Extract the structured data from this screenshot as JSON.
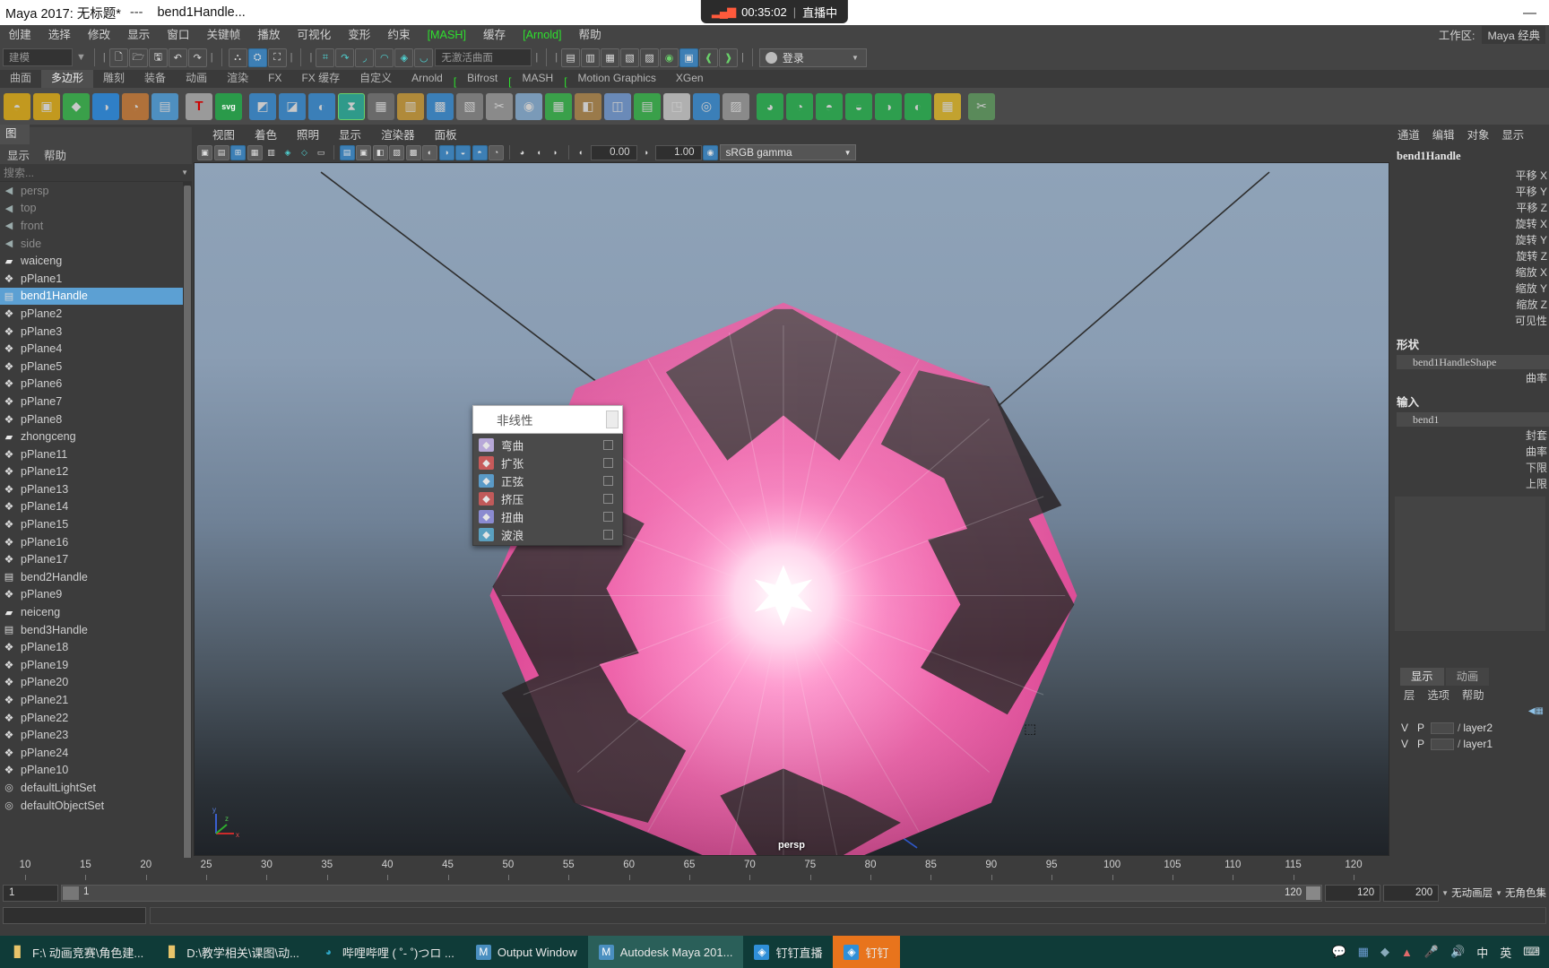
{
  "window": {
    "title_app": "Maya 2017: 无标题*",
    "title_sep": "---",
    "title_doc": "bend1Handle...",
    "minimize": "—",
    "live_timer": "00:35:02",
    "live_divider": "|",
    "live_label": "直播中"
  },
  "menubar": {
    "items": [
      {
        "label": "创建",
        "green": false
      },
      {
        "label": "选择",
        "green": false
      },
      {
        "label": "修改",
        "green": false
      },
      {
        "label": "显示",
        "green": false
      },
      {
        "label": "窗口",
        "green": false
      },
      {
        "label": "关键帧",
        "green": false
      },
      {
        "label": "播放",
        "green": false
      },
      {
        "label": "可视化",
        "green": false
      },
      {
        "label": "变形",
        "green": false
      },
      {
        "label": "约束",
        "green": false
      },
      {
        "label": "MASH",
        "green": true
      },
      {
        "label": "缓存",
        "green": false
      },
      {
        "label": "Arnold",
        "green": true
      },
      {
        "label": "帮助",
        "green": false
      }
    ],
    "workspace_label": "工作区:",
    "workspace_value": "Maya 经典"
  },
  "statusline": {
    "mode_value": "建模",
    "surface_field": "无激活曲面",
    "login_label": "登录"
  },
  "shelf": {
    "tabs": [
      {
        "label": "曲面",
        "active": false
      },
      {
        "label": "多边形",
        "active": true
      },
      {
        "label": "雕刻",
        "active": false
      },
      {
        "label": "装备",
        "active": false
      },
      {
        "label": "动画",
        "active": false
      },
      {
        "label": "渲染",
        "active": false
      },
      {
        "label": "FX",
        "active": false
      },
      {
        "label": "FX 缓存",
        "active": false
      },
      {
        "label": "自定义",
        "active": false
      },
      {
        "label": "Arnold",
        "active": false
      },
      {
        "label": "Bifrost",
        "active": false
      },
      {
        "label": "MASH",
        "active": false
      },
      {
        "label": "Motion Graphics",
        "active": false
      },
      {
        "label": "XGen",
        "active": false
      }
    ],
    "bracket": "["
  },
  "outliner": {
    "tab_label": "图",
    "menus": [
      "显示",
      "帮助"
    ],
    "search_placeholder": "搜索...",
    "items": [
      {
        "label": "persp",
        "icon": "camera-icon",
        "type": "cam",
        "dim": true,
        "selected": false
      },
      {
        "label": "top",
        "icon": "camera-icon",
        "type": "cam",
        "dim": true,
        "selected": false
      },
      {
        "label": "front",
        "icon": "camera-icon",
        "type": "cam",
        "dim": true,
        "selected": false
      },
      {
        "label": "side",
        "icon": "camera-icon",
        "type": "cam",
        "dim": true,
        "selected": false
      },
      {
        "label": "waiceng",
        "icon": "group-icon",
        "type": "grp",
        "dim": false,
        "selected": false
      },
      {
        "label": "pPlane1",
        "icon": "mesh-icon",
        "type": "mesh",
        "dim": false,
        "selected": false
      },
      {
        "label": "bend1Handle",
        "icon": "deformer-icon",
        "type": "bend",
        "dim": false,
        "selected": true
      },
      {
        "label": "pPlane2",
        "icon": "mesh-icon",
        "type": "mesh",
        "dim": false,
        "selected": false
      },
      {
        "label": "pPlane3",
        "icon": "mesh-icon",
        "type": "mesh",
        "dim": false,
        "selected": false
      },
      {
        "label": "pPlane4",
        "icon": "mesh-icon",
        "type": "mesh",
        "dim": false,
        "selected": false
      },
      {
        "label": "pPlane5",
        "icon": "mesh-icon",
        "type": "mesh",
        "dim": false,
        "selected": false
      },
      {
        "label": "pPlane6",
        "icon": "mesh-icon",
        "type": "mesh",
        "dim": false,
        "selected": false
      },
      {
        "label": "pPlane7",
        "icon": "mesh-icon",
        "type": "mesh",
        "dim": false,
        "selected": false
      },
      {
        "label": "pPlane8",
        "icon": "mesh-icon",
        "type": "mesh",
        "dim": false,
        "selected": false
      },
      {
        "label": "zhongceng",
        "icon": "group-icon",
        "type": "grp",
        "dim": false,
        "selected": false
      },
      {
        "label": "pPlane11",
        "icon": "mesh-icon",
        "type": "mesh",
        "dim": false,
        "selected": false
      },
      {
        "label": "pPlane12",
        "icon": "mesh-icon",
        "type": "mesh",
        "dim": false,
        "selected": false
      },
      {
        "label": "pPlane13",
        "icon": "mesh-icon",
        "type": "mesh",
        "dim": false,
        "selected": false
      },
      {
        "label": "pPlane14",
        "icon": "mesh-icon",
        "type": "mesh",
        "dim": false,
        "selected": false
      },
      {
        "label": "pPlane15",
        "icon": "mesh-icon",
        "type": "mesh",
        "dim": false,
        "selected": false
      },
      {
        "label": "pPlane16",
        "icon": "mesh-icon",
        "type": "mesh",
        "dim": false,
        "selected": false
      },
      {
        "label": "pPlane17",
        "icon": "mesh-icon",
        "type": "mesh",
        "dim": false,
        "selected": false
      },
      {
        "label": "bend2Handle",
        "icon": "deformer-icon",
        "type": "bend",
        "dim": false,
        "selected": false
      },
      {
        "label": "pPlane9",
        "icon": "mesh-icon",
        "type": "mesh",
        "dim": false,
        "selected": false
      },
      {
        "label": "neiceng",
        "icon": "group-icon",
        "type": "grp",
        "dim": false,
        "selected": false
      },
      {
        "label": "bend3Handle",
        "icon": "deformer-icon",
        "type": "bend",
        "dim": false,
        "selected": false
      },
      {
        "label": "pPlane18",
        "icon": "mesh-icon",
        "type": "mesh",
        "dim": false,
        "selected": false
      },
      {
        "label": "pPlane19",
        "icon": "mesh-icon",
        "type": "mesh",
        "dim": false,
        "selected": false
      },
      {
        "label": "pPlane20",
        "icon": "mesh-icon",
        "type": "mesh",
        "dim": false,
        "selected": false
      },
      {
        "label": "pPlane21",
        "icon": "mesh-icon",
        "type": "mesh",
        "dim": false,
        "selected": false
      },
      {
        "label": "pPlane22",
        "icon": "mesh-icon",
        "type": "mesh",
        "dim": false,
        "selected": false
      },
      {
        "label": "pPlane23",
        "icon": "mesh-icon",
        "type": "mesh",
        "dim": false,
        "selected": false
      },
      {
        "label": "pPlane24",
        "icon": "mesh-icon",
        "type": "mesh",
        "dim": false,
        "selected": false
      },
      {
        "label": "pPlane10",
        "icon": "mesh-icon",
        "type": "mesh",
        "dim": false,
        "selected": false
      },
      {
        "label": "defaultLightSet",
        "icon": "set-icon",
        "type": "set",
        "dim": false,
        "selected": false
      },
      {
        "label": "defaultObjectSet",
        "icon": "set-icon",
        "type": "set",
        "dim": false,
        "selected": false
      }
    ]
  },
  "viewport": {
    "menus": [
      "视图",
      "着色",
      "照明",
      "显示",
      "渲染器",
      "面板"
    ],
    "exposure_value": "0.00",
    "gamma_value": "1.00",
    "colorspace_value": "sRGB gamma",
    "camera_label": "persp",
    "axis_x": "x",
    "axis_y": "y",
    "axis_z": "z"
  },
  "popup": {
    "title": "非线性",
    "items": [
      {
        "label": "弯曲",
        "icon": "bend-deformer-icon"
      },
      {
        "label": "扩张",
        "icon": "flare-deformer-icon"
      },
      {
        "label": "正弦",
        "icon": "sine-deformer-icon"
      },
      {
        "label": "挤压",
        "icon": "squash-deformer-icon"
      },
      {
        "label": "扭曲",
        "icon": "twist-deformer-icon"
      },
      {
        "label": "波浪",
        "icon": "wave-deformer-icon"
      }
    ]
  },
  "channelbox": {
    "menus": [
      "通道",
      "编辑",
      "对象",
      "显示"
    ],
    "node_name": "bend1Handle",
    "attributes": [
      {
        "name": "平移 X"
      },
      {
        "name": "平移 Y"
      },
      {
        "name": "平移 Z"
      },
      {
        "name": "旋转 X"
      },
      {
        "name": "旋转 Y"
      },
      {
        "name": "旋转 Z"
      },
      {
        "name": "缩放 X"
      },
      {
        "name": "缩放 Y"
      },
      {
        "name": "缩放 Z"
      },
      {
        "name": "可见性"
      }
    ],
    "shape_label": "形状",
    "shape_value": "bend1HandleShape",
    "shape_attr": "曲率",
    "input_label": "输入",
    "input_value": "bend1",
    "input_attrs": [
      "封套",
      "曲率",
      "下限",
      "上限"
    ]
  },
  "layereditor": {
    "tabs": [
      {
        "label": "显示",
        "active": true
      },
      {
        "label": "动画",
        "active": false
      }
    ],
    "menus": [
      "层",
      "选项",
      "帮助"
    ],
    "layers": [
      {
        "v": "V",
        "p": "P",
        "name": "layer2"
      },
      {
        "v": "V",
        "p": "P",
        "name": "layer1"
      }
    ],
    "slash": "/"
  },
  "timeline": {
    "ticks": [
      "10",
      "15",
      "20",
      "25",
      "30",
      "35",
      "40",
      "45",
      "50",
      "55",
      "60",
      "65",
      "70",
      "75",
      "80",
      "85",
      "90",
      "95",
      "100",
      "105",
      "110",
      "115",
      "120"
    ],
    "current_frame": "1",
    "range_start": "120",
    "range_end": "200",
    "playback_end": "120",
    "anim_layer": "无动画层",
    "char_set": "无角色集",
    "range_field_1": "120",
    "range_field_2": "200"
  },
  "taskbar": {
    "items": [
      {
        "label": "F:\\ 动画竞赛\\角色建...",
        "icon": "folder-icon",
        "style": "normal"
      },
      {
        "label": "D:\\教学相关\\课图\\动...",
        "icon": "folder-icon",
        "style": "normal"
      },
      {
        "label": "哔哩哔哩 ( ˚- ˚)つロ ...",
        "icon": "edge-icon",
        "style": "normal"
      },
      {
        "label": "Output Window",
        "icon": "maya-icon",
        "style": "normal"
      },
      {
        "label": "Autodesk Maya 201...",
        "icon": "maya-icon",
        "style": "active"
      },
      {
        "label": "钉钉直播",
        "icon": "dingtalk-icon",
        "style": "normal"
      },
      {
        "label": "钉钉",
        "icon": "dingtalk-icon",
        "style": "orange"
      }
    ],
    "tray": [
      "中",
      "英"
    ]
  }
}
